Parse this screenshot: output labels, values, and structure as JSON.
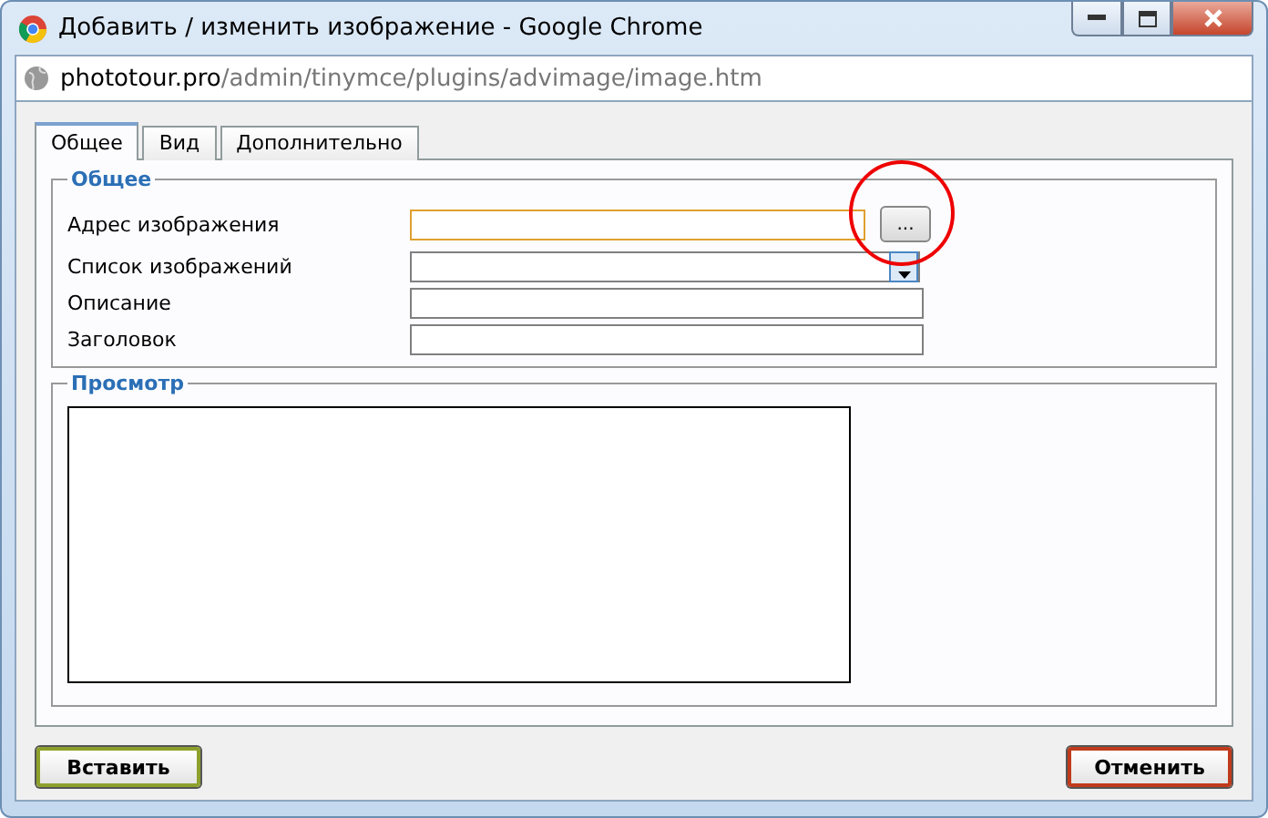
{
  "window": {
    "title": "Добавить / изменить изображение - Google Chrome"
  },
  "address_bar": {
    "host": "phototour.pro",
    "path": "/admin/tinymce/plugins/advimage/image.htm"
  },
  "tabs": [
    {
      "label": "Общее",
      "selected": true
    },
    {
      "label": "Вид",
      "selected": false
    },
    {
      "label": "Дополнительно",
      "selected": false
    }
  ],
  "general": {
    "legend": "Общее",
    "fields": [
      {
        "label": "Адрес изображения",
        "kind": "browse",
        "focused": true,
        "button": "..."
      },
      {
        "label": "Список изображений",
        "kind": "select",
        "focused": false
      },
      {
        "label": "Описание",
        "kind": "text",
        "focused": false
      },
      {
        "label": "Заголовок",
        "kind": "text",
        "focused": false
      }
    ]
  },
  "preview": {
    "legend": "Просмотр"
  },
  "buttons": [
    {
      "label": "Вставить",
      "kind": "insert"
    },
    {
      "label": "Отменить",
      "kind": "cancel"
    }
  ]
}
